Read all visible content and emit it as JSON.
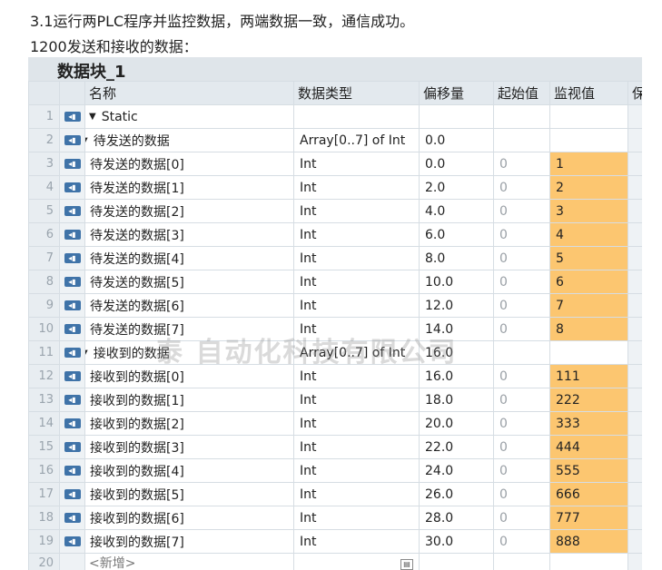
{
  "intro_line1": "3.1运行两PLC程序并监控数据，两端数据一致，通信成功。",
  "intro_line2": "1200发送和接收的数据：",
  "block_title": "数据块_1",
  "columns": {
    "name": "名称",
    "type": "数据类型",
    "offset": "偏移量",
    "start": "起始值",
    "monitor": "监视值",
    "extra": "保"
  },
  "watermark": "泰    自动化科技有限公司",
  "rows": [
    {
      "n": "1",
      "name": "Static",
      "type": "",
      "offset": "",
      "start": "",
      "monitor": "",
      "level": 0,
      "expand": true,
      "bullet": false,
      "hl": false
    },
    {
      "n": "2",
      "name": "待发送的数据",
      "type": "Array[0..7] of Int",
      "offset": "0.0",
      "start": "",
      "monitor": "",
      "level": 1,
      "expand": true,
      "bullet": true,
      "hl": false
    },
    {
      "n": "3",
      "name": "待发送的数据[0]",
      "type": "Int",
      "offset": "0.0",
      "start": "0",
      "monitor": "1",
      "level": 2,
      "expand": false,
      "bullet": true,
      "hl": true
    },
    {
      "n": "4",
      "name": "待发送的数据[1]",
      "type": "Int",
      "offset": "2.0",
      "start": "0",
      "monitor": "2",
      "level": 2,
      "expand": false,
      "bullet": true,
      "hl": true
    },
    {
      "n": "5",
      "name": "待发送的数据[2]",
      "type": "Int",
      "offset": "4.0",
      "start": "0",
      "monitor": "3",
      "level": 2,
      "expand": false,
      "bullet": true,
      "hl": true
    },
    {
      "n": "6",
      "name": "待发送的数据[3]",
      "type": "Int",
      "offset": "6.0",
      "start": "0",
      "monitor": "4",
      "level": 2,
      "expand": false,
      "bullet": true,
      "hl": true
    },
    {
      "n": "7",
      "name": "待发送的数据[4]",
      "type": "Int",
      "offset": "8.0",
      "start": "0",
      "monitor": "5",
      "level": 2,
      "expand": false,
      "bullet": true,
      "hl": true
    },
    {
      "n": "8",
      "name": "待发送的数据[5]",
      "type": "Int",
      "offset": "10.0",
      "start": "0",
      "monitor": "6",
      "level": 2,
      "expand": false,
      "bullet": true,
      "hl": true
    },
    {
      "n": "9",
      "name": "待发送的数据[6]",
      "type": "Int",
      "offset": "12.0",
      "start": "0",
      "monitor": "7",
      "level": 2,
      "expand": false,
      "bullet": true,
      "hl": true
    },
    {
      "n": "10",
      "name": "待发送的数据[7]",
      "type": "Int",
      "offset": "14.0",
      "start": "0",
      "monitor": "8",
      "level": 2,
      "expand": false,
      "bullet": true,
      "hl": true
    },
    {
      "n": "11",
      "name": "接收到的数据",
      "type": "Array[0..7] of Int",
      "offset": "16.0",
      "start": "",
      "monitor": "",
      "level": 1,
      "expand": true,
      "bullet": true,
      "hl": false
    },
    {
      "n": "12",
      "name": "接收到的数据[0]",
      "type": "Int",
      "offset": "16.0",
      "start": "0",
      "monitor": "111",
      "level": 2,
      "expand": false,
      "bullet": true,
      "hl": true
    },
    {
      "n": "13",
      "name": "接收到的数据[1]",
      "type": "Int",
      "offset": "18.0",
      "start": "0",
      "monitor": "222",
      "level": 2,
      "expand": false,
      "bullet": true,
      "hl": true
    },
    {
      "n": "14",
      "name": "接收到的数据[2]",
      "type": "Int",
      "offset": "20.0",
      "start": "0",
      "monitor": "333",
      "level": 2,
      "expand": false,
      "bullet": true,
      "hl": true
    },
    {
      "n": "15",
      "name": "接收到的数据[3]",
      "type": "Int",
      "offset": "22.0",
      "start": "0",
      "monitor": "444",
      "level": 2,
      "expand": false,
      "bullet": true,
      "hl": true
    },
    {
      "n": "16",
      "name": "接收到的数据[4]",
      "type": "Int",
      "offset": "24.0",
      "start": "0",
      "monitor": "555",
      "level": 2,
      "expand": false,
      "bullet": true,
      "hl": true
    },
    {
      "n": "17",
      "name": "接收到的数据[5]",
      "type": "Int",
      "offset": "26.0",
      "start": "0",
      "monitor": "666",
      "level": 2,
      "expand": false,
      "bullet": true,
      "hl": true
    },
    {
      "n": "18",
      "name": "接收到的数据[6]",
      "type": "Int",
      "offset": "28.0",
      "start": "0",
      "monitor": "777",
      "level": 2,
      "expand": false,
      "bullet": true,
      "hl": true
    },
    {
      "n": "19",
      "name": "接收到的数据[7]",
      "type": "Int",
      "offset": "30.0",
      "start": "0",
      "monitor": "888",
      "level": 2,
      "expand": false,
      "bullet": true,
      "hl": true
    }
  ],
  "new_row": {
    "n": "20",
    "name": "<新增>"
  },
  "colors": {
    "highlight": "#fcc670",
    "icon": "#3f73a8",
    "bullet": "#2a66c4"
  }
}
